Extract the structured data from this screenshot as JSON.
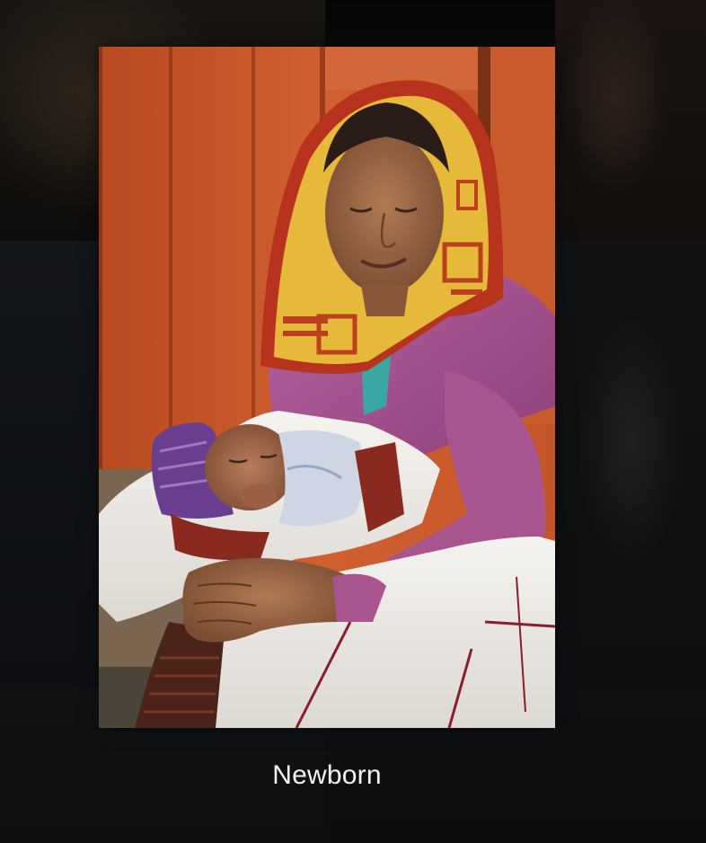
{
  "viewer": {
    "caption": "Newborn"
  },
  "photo": {
    "subject": "woman-holding-newborn-photo"
  },
  "colors": {
    "background": "#0c0d0f",
    "caption_text": "#f2f2f2",
    "wall_orange": "#c95a2c",
    "cardigan_purple": "#a8548f",
    "headscarf_yellow": "#e6b93a",
    "headscarf_red": "#b8331d"
  }
}
